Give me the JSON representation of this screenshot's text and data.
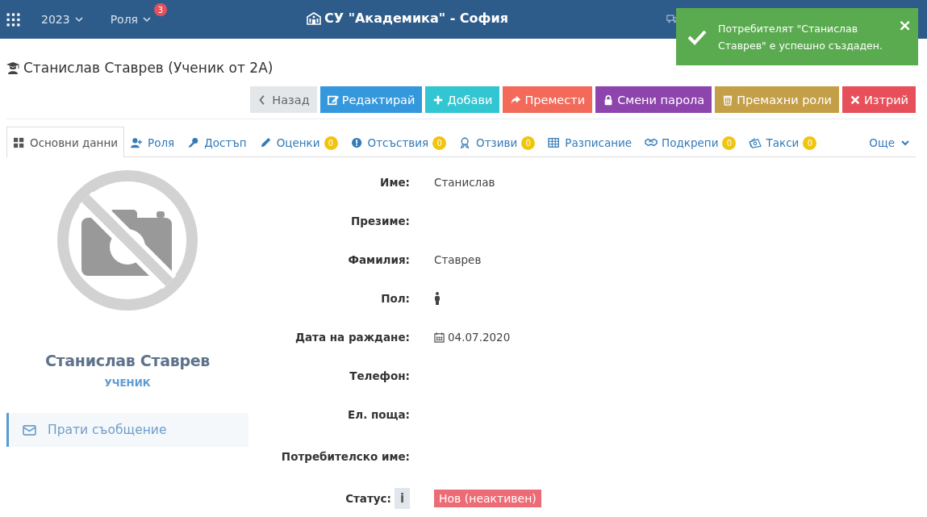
{
  "topbar": {
    "year": "2023",
    "role_menu": "Роля",
    "role_badge": "3",
    "school": "СУ \"Академика\" - София"
  },
  "toast": {
    "message": "Потребителят \"Станислав Ставрев\" е успешно създаден.",
    "close": "×"
  },
  "page_title": "Станислав Ставрев (Ученик от 2А)",
  "actions": [
    {
      "label": "Назад",
      "kind": "back",
      "color": "#e4e7ea"
    },
    {
      "label": "Редактирай",
      "kind": "edit",
      "color": "#3598dc"
    },
    {
      "label": "Добави",
      "kind": "add",
      "color": "#32c5d2"
    },
    {
      "label": "Премести",
      "kind": "move",
      "color": "#f36a5a"
    },
    {
      "label": "Смени парола",
      "kind": "lock",
      "color": "#8e44ad"
    },
    {
      "label": "Премахни роли",
      "kind": "trash",
      "color": "#c49f47"
    },
    {
      "label": "Изтрий",
      "kind": "delete",
      "color": "#e7505a"
    }
  ],
  "tabs": [
    {
      "label": "Основни данни",
      "kind": "grid",
      "selected": true
    },
    {
      "label": "Роля",
      "kind": "user-plus",
      "selected": false
    },
    {
      "label": "Достъп",
      "kind": "key",
      "selected": false
    },
    {
      "label": "Оценки",
      "kind": "pencil",
      "badge": "0",
      "selected": false
    },
    {
      "label": "Отсъствия",
      "kind": "alert",
      "badge": "0",
      "selected": false
    },
    {
      "label": "Отзиви",
      "kind": "award",
      "badge": "0",
      "selected": false
    },
    {
      "label": "Разписание",
      "kind": "table",
      "selected": false
    },
    {
      "label": "Подкрепи",
      "kind": "handshake",
      "badge": "0",
      "selected": false
    },
    {
      "label": "Такси",
      "kind": "money",
      "badge": "0",
      "selected": false
    }
  ],
  "more_tab": "Още",
  "profile": {
    "name": "Станислав Ставрев",
    "role": "УЧЕНИК",
    "message_button": "Прати съобщение"
  },
  "details": [
    {
      "label": "Име:",
      "kind": "text",
      "value": "Станислав"
    },
    {
      "label": "Презиме:",
      "kind": "empty"
    },
    {
      "label": "Фамилия:",
      "kind": "text",
      "value": "Ставрев"
    },
    {
      "label": "Пол:",
      "kind": "gender"
    },
    {
      "label": "Дата на раждане:",
      "kind": "date",
      "value": "04.07.2020"
    },
    {
      "label": "Телефон:",
      "kind": "empty"
    },
    {
      "label": "Ел. поща:",
      "kind": "empty"
    },
    {
      "label": "Потребителско име:",
      "kind": "empty"
    },
    {
      "label": "Статус:",
      "kind": "status",
      "value": "Нов (неактивен)",
      "color": "#ed6b75",
      "info": "i"
    }
  ]
}
